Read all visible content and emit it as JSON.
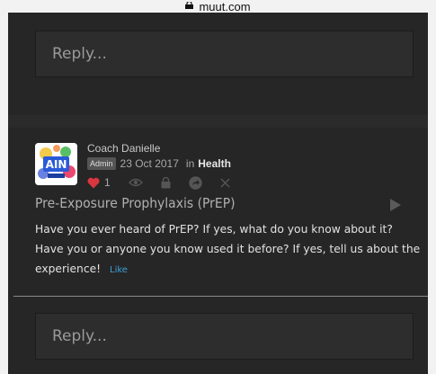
{
  "browser": {
    "url": "muut.com"
  },
  "reply_top": {
    "placeholder": "Reply..."
  },
  "post": {
    "author": "Coach Danielle",
    "role_badge": "Admin",
    "date": "23 Oct 2017",
    "in_label": "in",
    "category": "Health",
    "likes": "1",
    "title": "Pre-Exposure Prophylaxis (PrEP)",
    "body": "Have you ever heard of PrEP? If yes, what do you know about it? Have you or anyone you know used it before? If yes, tell us about the experience!",
    "like_link": "Like",
    "icons": [
      "heart-icon",
      "eye-icon",
      "lock-icon",
      "share-icon",
      "close-icon",
      "play-icon"
    ],
    "colors": {
      "heart": "#d9363e",
      "link": "#3ea0d8"
    }
  },
  "reply_bottom": {
    "placeholder": "Reply..."
  }
}
